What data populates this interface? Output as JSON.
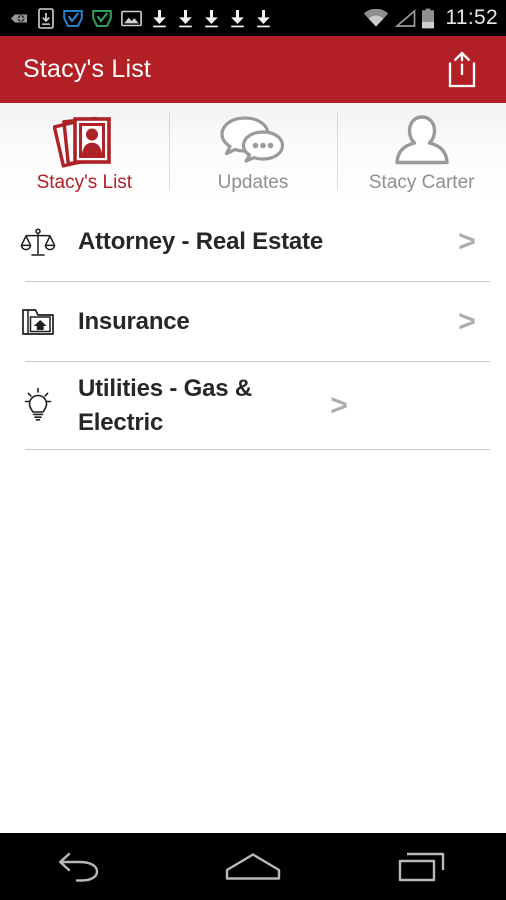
{
  "status_bar": {
    "clock": "11:52",
    "left_icons": [
      {
        "name": "plugin-badge-icon",
        "label": "add-on"
      },
      {
        "name": "download-to-device-icon",
        "label": "save to device"
      },
      {
        "name": "checkbox-blue-icon",
        "label": "task complete blue"
      },
      {
        "name": "checkbox-green-icon",
        "label": "task complete green"
      },
      {
        "name": "image-icon",
        "label": "screenshot"
      },
      {
        "name": "download-icon-1",
        "label": "download"
      },
      {
        "name": "download-icon-2",
        "label": "download"
      },
      {
        "name": "download-icon-3",
        "label": "download"
      },
      {
        "name": "download-icon-4",
        "label": "download"
      },
      {
        "name": "download-icon-5",
        "label": "download"
      }
    ],
    "right_icons": [
      {
        "name": "wifi-icon",
        "label": "wifi"
      },
      {
        "name": "cell-signal-icon",
        "label": "signal"
      },
      {
        "name": "battery-icon",
        "label": "battery"
      }
    ]
  },
  "app_bar": {
    "title": "Stacy's List",
    "share_icon": "share-icon",
    "background_color": "#b22026",
    "text_color": "#ffffff"
  },
  "tabs": [
    {
      "id": "stacys-list",
      "label": "Stacy's List",
      "icon": "contact-cards-icon",
      "active": true,
      "color": "#b22026"
    },
    {
      "id": "updates",
      "label": "Updates",
      "icon": "chat-bubbles-icon",
      "active": false,
      "color": "#8f8f8f"
    },
    {
      "id": "stacy-carter",
      "label": "Stacy Carter",
      "icon": "person-icon",
      "active": false,
      "color": "#8f8f8f"
    }
  ],
  "list": {
    "rows": [
      {
        "label": "Attorney - Real Estate",
        "icon": "scales-of-justice-icon",
        "chevron": ">"
      },
      {
        "label": "Insurance",
        "icon": "folder-house-icon",
        "chevron": ">"
      },
      {
        "label": "Utilities - Gas & Electric",
        "icon": "lightbulb-icon",
        "chevron": ">"
      }
    ]
  },
  "nav_bar": {
    "buttons": [
      {
        "name": "back-button",
        "icon": "back-arrow-icon"
      },
      {
        "name": "home-button",
        "icon": "home-icon"
      },
      {
        "name": "recents-button",
        "icon": "recents-icon"
      }
    ]
  }
}
